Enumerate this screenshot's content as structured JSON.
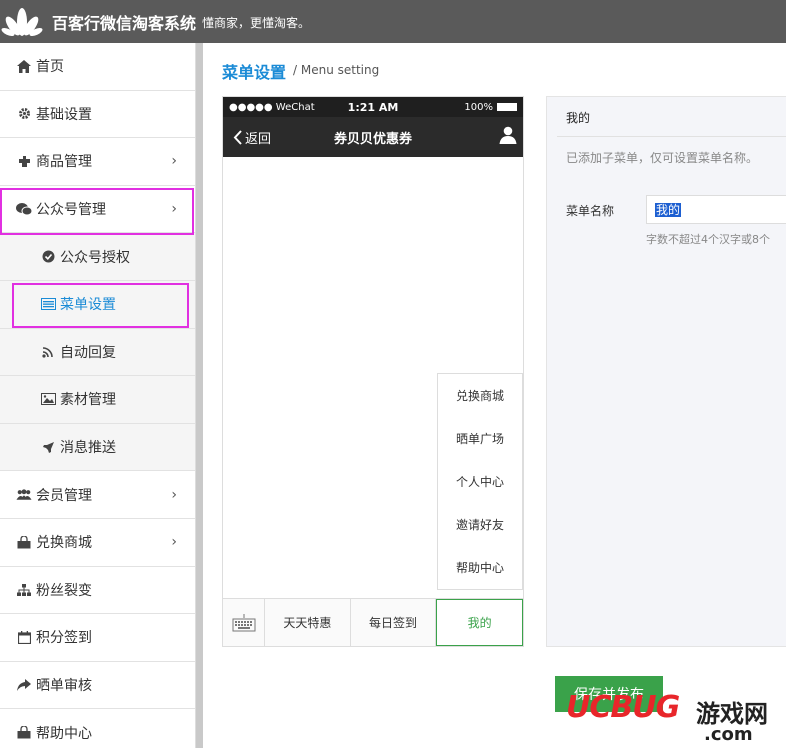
{
  "header": {
    "brand": "百客行微信淘客系统",
    "slogan": "懂商家，更懂淘客。"
  },
  "sidebar": {
    "items": [
      {
        "label": "首页",
        "icon": "home-icon"
      },
      {
        "label": "基础设置",
        "icon": "gear-icon"
      },
      {
        "label": "商品管理",
        "icon": "puzzle-icon",
        "chevron": true
      },
      {
        "label": "公众号管理",
        "icon": "wechat-icon",
        "chevron": true
      },
      {
        "label": "公众号授权",
        "icon": "check-circle-icon",
        "sub": true
      },
      {
        "label": "菜单设置",
        "icon": "list-alt-icon",
        "sub": true,
        "active": true
      },
      {
        "label": "自动回复",
        "icon": "rss-icon",
        "sub": true
      },
      {
        "label": "素材管理",
        "icon": "picture-icon",
        "sub": true
      },
      {
        "label": "消息推送",
        "icon": "rocket-icon",
        "sub": true
      },
      {
        "label": "会员管理",
        "icon": "users-icon",
        "chevron": true
      },
      {
        "label": "兑换商城",
        "icon": "shopping-bag-icon",
        "chevron": true
      },
      {
        "label": "粉丝裂变",
        "icon": "sitemap-icon"
      },
      {
        "label": "积分签到",
        "icon": "calendar-icon"
      },
      {
        "label": "晒单审核",
        "icon": "share-icon"
      },
      {
        "label": "帮助中心",
        "icon": "help-icon"
      }
    ]
  },
  "page": {
    "title": "菜单设置",
    "subtitle": "/ Menu setting"
  },
  "phone": {
    "carrier": "●●●●● WeChat",
    "time": "1:21 AM",
    "battery": "100%",
    "back_label": "返回",
    "title": "券贝贝优惠券",
    "submenu": [
      "兑换商城",
      "晒单广场",
      "个人中心",
      "邀请好友",
      "帮助中心"
    ],
    "menu": [
      {
        "label": "天天特惠"
      },
      {
        "label": "每日签到"
      },
      {
        "label": "我的",
        "active": true
      }
    ]
  },
  "editor": {
    "title": "我的",
    "note": "已添加子菜单，仅可设置菜单名称。",
    "field_label": "菜单名称",
    "field_value": "我的",
    "hint": "字数不超过4个汉字或8个"
  },
  "actions": {
    "save_label": "保存并发布"
  },
  "watermark": {
    "brand_ucbug": "UCBUG",
    "brand_game": "游戏网",
    "domain": ".com"
  },
  "colors": {
    "accent_blue": "#1b8bd6",
    "active_green": "#3aa24a",
    "highlight_magenta": "#e130e1",
    "header_gray": "#5a5a5a"
  }
}
